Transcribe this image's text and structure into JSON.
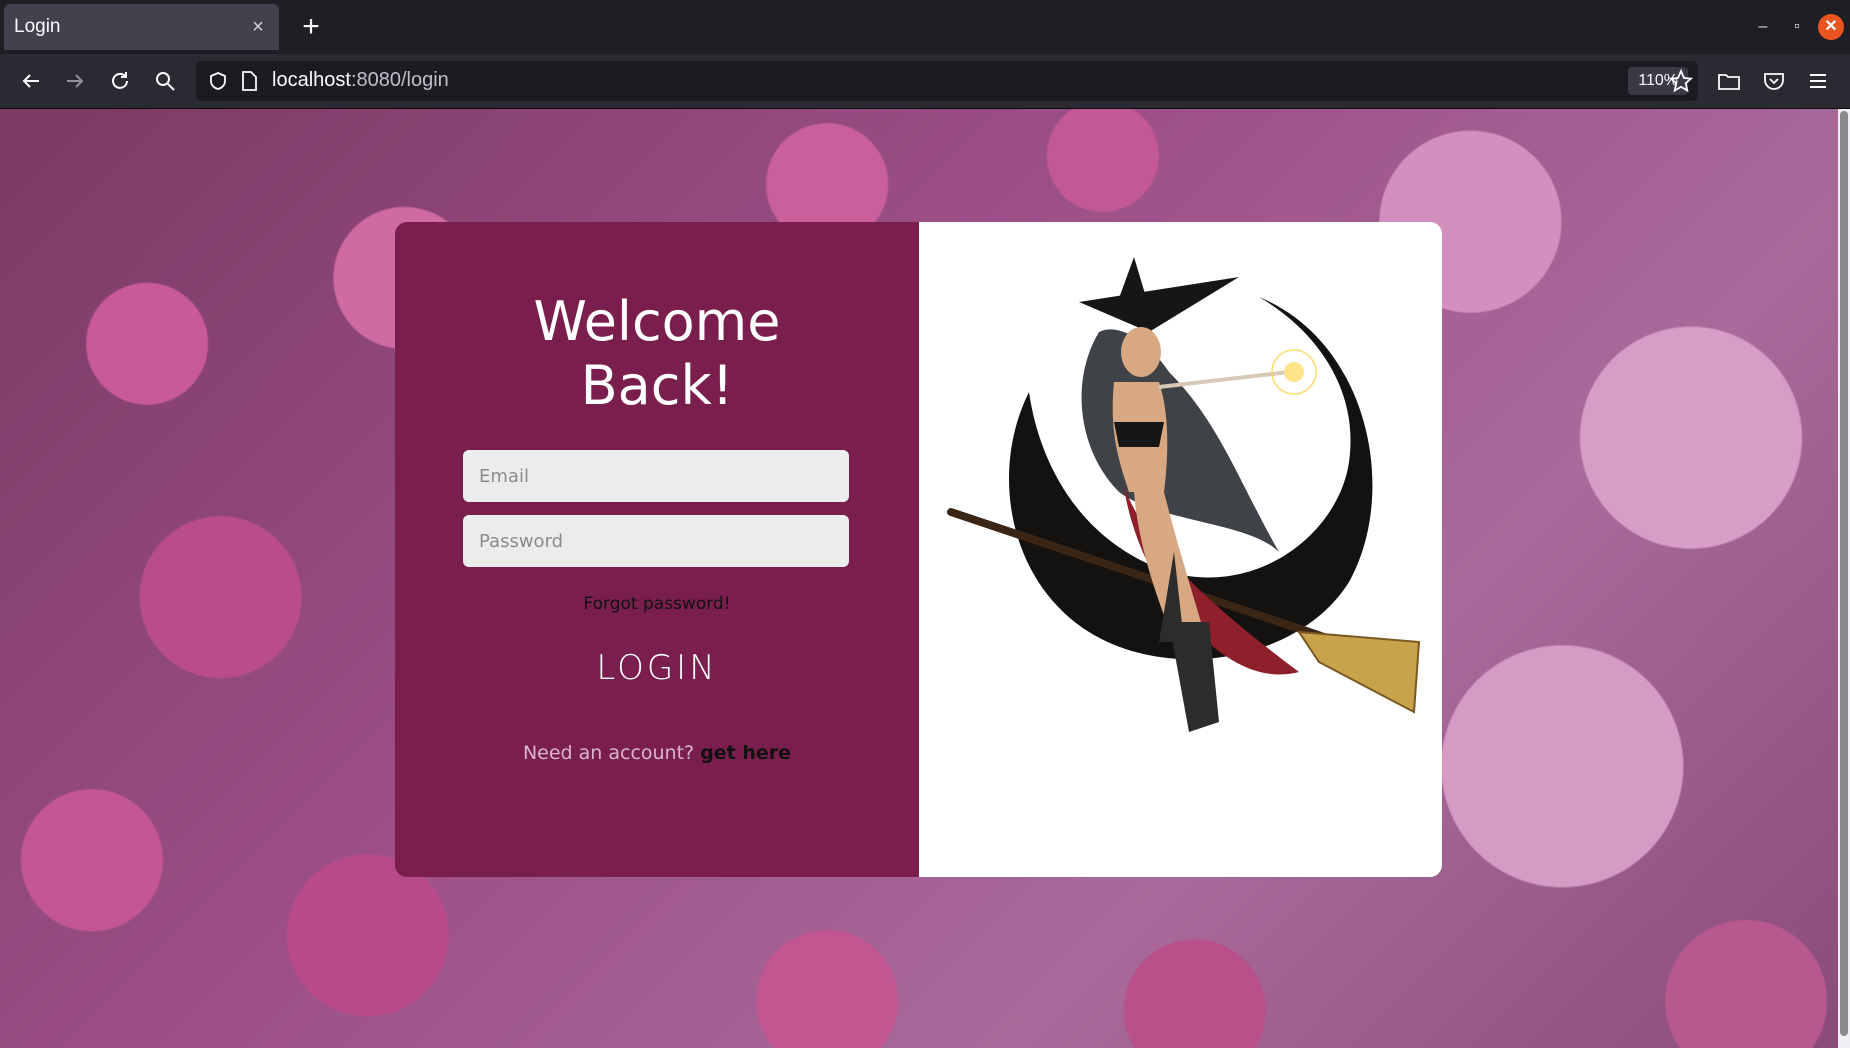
{
  "browser": {
    "tab_title": "Login",
    "tab_close": "×",
    "new_tab": "+",
    "url_host": "localhost",
    "url_path": ":8080/login",
    "zoom": "110%"
  },
  "login": {
    "title_line1": "Welcome",
    "title_line2": "Back!",
    "email_placeholder": "Email",
    "password_placeholder": "Password",
    "forgot_label": "Forgot password!",
    "login_label": "LOGIN",
    "signup_prompt": "Need an account?",
    "signup_link": "get here"
  },
  "colors": {
    "panel": "#7a1f4d",
    "input_bg": "#ececec",
    "browser_chrome": "#2b2a33"
  },
  "illustration": "witch-on-broom-crescent-moon"
}
